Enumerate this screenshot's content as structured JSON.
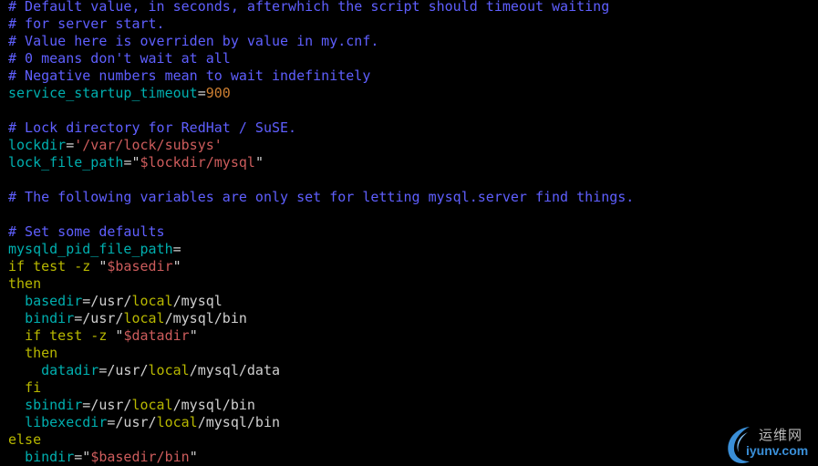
{
  "colors": {
    "background": "#000000",
    "comment": "#5f5fff",
    "variable": "#00afaf",
    "string": "#cd5c5c",
    "number": "#cd7f32",
    "keyword": "#b8b800",
    "plain": "#d0d0d0"
  },
  "lines": [
    [
      {
        "t": "comment",
        "v": "# Default value, in seconds, afterwhich the script should timeout waiting"
      }
    ],
    [
      {
        "t": "comment",
        "v": "# for server start."
      }
    ],
    [
      {
        "t": "comment",
        "v": "# Value here is overriden by value in my.cnf."
      }
    ],
    [
      {
        "t": "comment",
        "v": "# 0 means don't wait at all"
      }
    ],
    [
      {
        "t": "comment",
        "v": "# Negative numbers mean to wait indefinitely"
      }
    ],
    [
      {
        "t": "var",
        "v": "service_startup_timeout"
      },
      {
        "t": "op",
        "v": "="
      },
      {
        "t": "num",
        "v": "900"
      }
    ],
    [],
    [
      {
        "t": "comment",
        "v": "# Lock directory for RedHat / SuSE."
      }
    ],
    [
      {
        "t": "var",
        "v": "lockdir"
      },
      {
        "t": "op",
        "v": "="
      },
      {
        "t": "str",
        "v": "'/var/lock/subsys'"
      }
    ],
    [
      {
        "t": "var",
        "v": "lock_file_path"
      },
      {
        "t": "op",
        "v": "="
      },
      {
        "t": "quote",
        "v": "\""
      },
      {
        "t": "str",
        "v": "$lockdir/mysql"
      },
      {
        "t": "quote",
        "v": "\""
      }
    ],
    [],
    [
      {
        "t": "comment",
        "v": "# The following variables are only set for letting mysql.server find things."
      }
    ],
    [],
    [
      {
        "t": "comment",
        "v": "# Set some defaults"
      }
    ],
    [
      {
        "t": "var",
        "v": "mysqld_pid_file_path"
      },
      {
        "t": "op",
        "v": "="
      }
    ],
    [
      {
        "t": "kw",
        "v": "if test -z "
      },
      {
        "t": "quote",
        "v": "\""
      },
      {
        "t": "str",
        "v": "$basedir"
      },
      {
        "t": "quote",
        "v": "\""
      }
    ],
    [
      {
        "t": "kw",
        "v": "then"
      }
    ],
    [
      {
        "t": "plain",
        "v": "  "
      },
      {
        "t": "var",
        "v": "basedir"
      },
      {
        "t": "op",
        "v": "=/usr/"
      },
      {
        "t": "kw",
        "v": "local"
      },
      {
        "t": "plain",
        "v": "/mysql"
      }
    ],
    [
      {
        "t": "plain",
        "v": "  "
      },
      {
        "t": "var",
        "v": "bindir"
      },
      {
        "t": "op",
        "v": "=/usr/"
      },
      {
        "t": "kw",
        "v": "local"
      },
      {
        "t": "plain",
        "v": "/mysql/bin"
      }
    ],
    [
      {
        "t": "plain",
        "v": "  "
      },
      {
        "t": "kw",
        "v": "if test -z "
      },
      {
        "t": "quote",
        "v": "\""
      },
      {
        "t": "str",
        "v": "$datadir"
      },
      {
        "t": "quote",
        "v": "\""
      }
    ],
    [
      {
        "t": "plain",
        "v": "  "
      },
      {
        "t": "kw",
        "v": "then"
      }
    ],
    [
      {
        "t": "plain",
        "v": "    "
      },
      {
        "t": "var",
        "v": "datadir"
      },
      {
        "t": "op",
        "v": "=/usr/"
      },
      {
        "t": "kw",
        "v": "local"
      },
      {
        "t": "plain",
        "v": "/mysql/data"
      }
    ],
    [
      {
        "t": "plain",
        "v": "  "
      },
      {
        "t": "kw",
        "v": "fi"
      }
    ],
    [
      {
        "t": "plain",
        "v": "  "
      },
      {
        "t": "var",
        "v": "sbindir"
      },
      {
        "t": "op",
        "v": "=/usr/"
      },
      {
        "t": "kw",
        "v": "local"
      },
      {
        "t": "plain",
        "v": "/mysql/bin"
      }
    ],
    [
      {
        "t": "plain",
        "v": "  "
      },
      {
        "t": "var",
        "v": "libexecdir"
      },
      {
        "t": "op",
        "v": "=/usr/"
      },
      {
        "t": "kw",
        "v": "local"
      },
      {
        "t": "plain",
        "v": "/mysql/bin"
      }
    ],
    [
      {
        "t": "kw",
        "v": "else"
      }
    ],
    [
      {
        "t": "plain",
        "v": "  "
      },
      {
        "t": "var",
        "v": "bindir"
      },
      {
        "t": "op",
        "v": "="
      },
      {
        "t": "quote",
        "v": "\""
      },
      {
        "t": "str",
        "v": "$basedir/bin"
      },
      {
        "t": "quote",
        "v": "\""
      }
    ]
  ],
  "watermark": {
    "chinese": "运维网",
    "domain": "iyunv.com",
    "icon": "swoosh-logo-icon"
  }
}
